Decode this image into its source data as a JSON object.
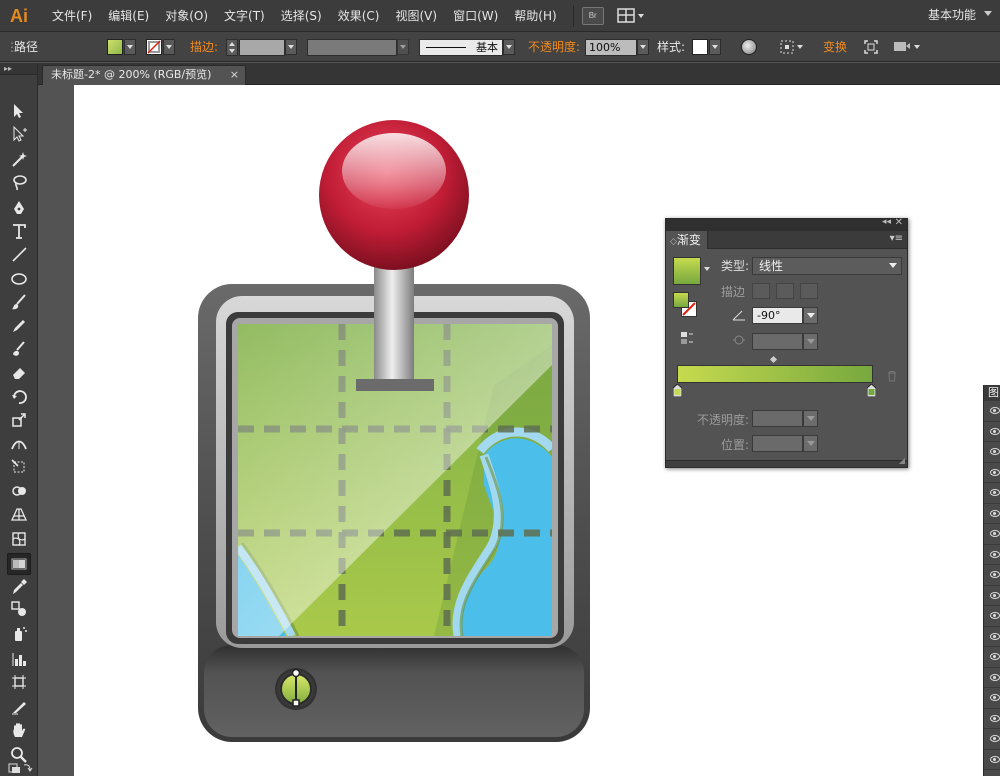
{
  "app": {
    "logo": "Ai"
  },
  "menu": {
    "items": [
      "文件(F)",
      "编辑(E)",
      "对象(O)",
      "文字(T)",
      "选择(S)",
      "效果(C)",
      "视图(V)",
      "窗口(W)",
      "帮助(H)"
    ],
    "bridge_label": "Br",
    "workspace": "基本功能"
  },
  "control": {
    "selection_type": "路径",
    "fill_color": "#b4cf5a",
    "stroke_label": "描边:",
    "stroke_profile": "基本",
    "opacity_label": "不透明度:",
    "opacity_value": "100%",
    "style_label": "样式:",
    "transform_label": "变换"
  },
  "document": {
    "tab_title": "未标题-2* @ 200% (RGB/预览)",
    "close_label": "×"
  },
  "tools": [
    "selection-tool",
    "direct-selection-tool",
    "magic-wand-tool",
    "lasso-tool",
    "pen-tool",
    "type-tool",
    "line-tool",
    "ellipse-tool",
    "paintbrush-tool",
    "pencil-tool",
    "blob-brush-tool",
    "eraser-tool",
    "rotate-tool",
    "scale-tool",
    "width-tool",
    "free-transform-tool",
    "shape-builder-tool",
    "perspective-grid-tool",
    "mesh-tool",
    "gradient-tool",
    "eyedropper-tool",
    "blend-tool",
    "symbol-sprayer-tool",
    "column-graph-tool",
    "artboard-tool",
    "slice-tool",
    "hand-tool",
    "zoom-tool"
  ],
  "active_tool": "gradient-tool",
  "gradient_panel": {
    "tab": "渐变",
    "type_label": "类型:",
    "type_value": "线性",
    "stroke_label": "描边",
    "angle_value": "-90°",
    "opacity_label": "不透明度:",
    "position_label": "位置:",
    "gradient_start": "#c6da4e",
    "gradient_end": "#77a83f"
  },
  "layers_panel": {
    "tab_initial": "图"
  },
  "colors": {
    "ui_dark": "#3c3c3c",
    "accent_orange": "#f28a1c",
    "pin_red": "#c8213a",
    "map_green": "#8fb84a",
    "water_blue": "#4bbfe9"
  }
}
